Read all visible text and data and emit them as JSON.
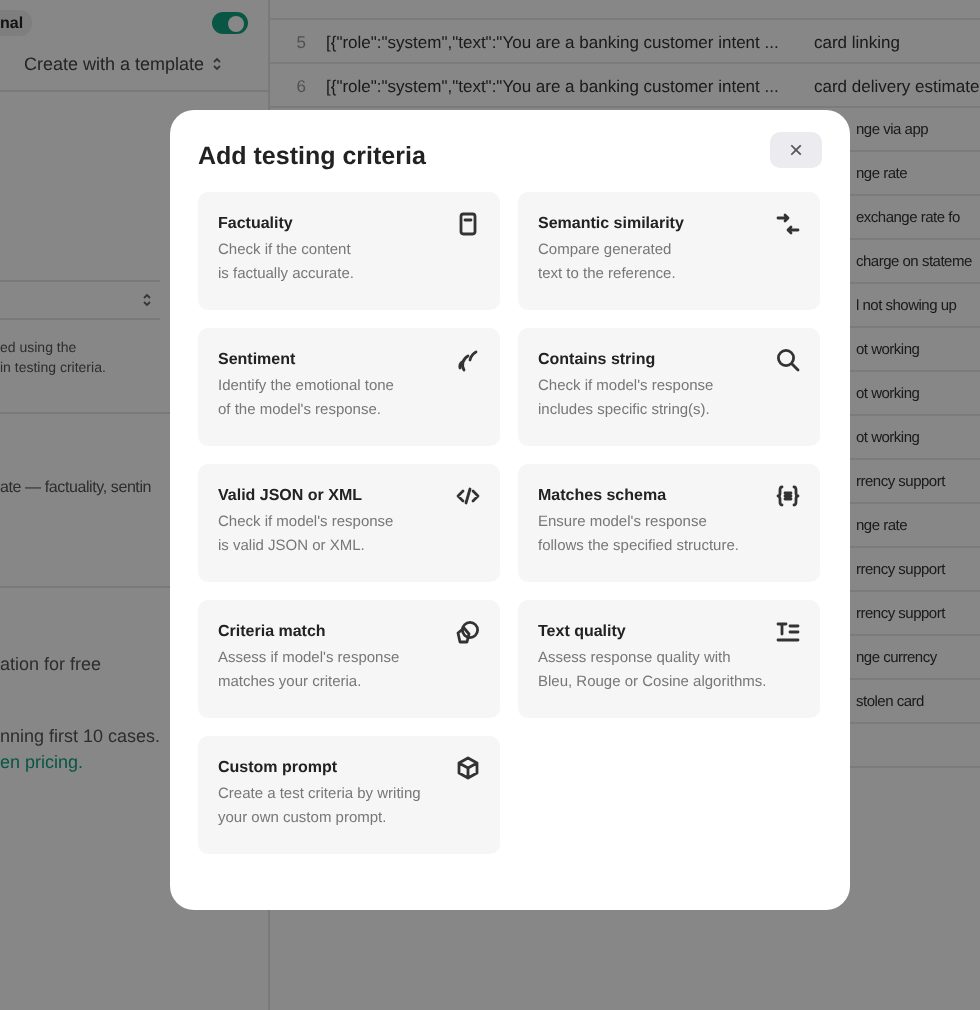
{
  "sidebar": {
    "badge": "nal",
    "toggle": {
      "on": true
    },
    "template_button": "Create with a template",
    "note": "ed using the\nin testing criteria.",
    "description": "ate — factuality, sentin",
    "free_text": "ation for free",
    "pricing_text": "nning first 10 cases.",
    "pricing_link": "en pricing."
  },
  "table": {
    "rows": [
      {
        "number": "",
        "prompt": "",
        "label": ""
      },
      {
        "number": "5",
        "prompt": "[{\"role\":\"system\",\"text\":\"You are a banking customer intent ...",
        "label": "card linking"
      },
      {
        "number": "6",
        "prompt": "[{\"role\":\"system\",\"text\":\"You are a banking customer intent ...",
        "label": "card delivery estimate"
      },
      {
        "number": "",
        "prompt": "",
        "label": "nge via app"
      },
      {
        "number": "",
        "prompt": "",
        "label": "nge rate"
      },
      {
        "number": "",
        "prompt": "",
        "label": "exchange rate fo"
      },
      {
        "number": "",
        "prompt": "",
        "label": "charge on stateme"
      },
      {
        "number": "",
        "prompt": "",
        "label": "l not showing up"
      },
      {
        "number": "",
        "prompt": "",
        "label": "ot working"
      },
      {
        "number": "",
        "prompt": "",
        "label": "ot working"
      },
      {
        "number": "",
        "prompt": "",
        "label": "ot working"
      },
      {
        "number": "",
        "prompt": "",
        "label": "rrency support"
      },
      {
        "number": "",
        "prompt": "",
        "label": "nge rate"
      },
      {
        "number": "",
        "prompt": "",
        "label": "rrency support"
      },
      {
        "number": "",
        "prompt": "",
        "label": "rrency support"
      },
      {
        "number": "",
        "prompt": "",
        "label": "nge currency"
      },
      {
        "number": "",
        "prompt": "",
        "label": "stolen card"
      },
      {
        "number": "",
        "prompt": "",
        "label": ""
      }
    ]
  },
  "dialog": {
    "title": "Add testing criteria",
    "close": "×",
    "criteria": [
      {
        "title": "Factuality",
        "description": "Check if the content\nis factually accurate."
      },
      {
        "title": "Semantic similarity",
        "description": "Compare generated\ntext to the reference."
      },
      {
        "title": "Sentiment",
        "description": "Identify the emotional tone\nof the model's response."
      },
      {
        "title": "Contains string",
        "description": "Check if model's response\nincludes specific string(s)."
      },
      {
        "title": "Valid JSON or XML",
        "description": "Check if model's response\nis valid JSON or XML."
      },
      {
        "title": "Matches schema",
        "description": "Ensure model's response\nfollows the specified structure."
      },
      {
        "title": "Criteria match",
        "description": "Assess if model's response\nmatches your criteria."
      },
      {
        "title": "Text quality",
        "description": "Assess response quality with\nBleu, Rouge or Cosine algorithms."
      },
      {
        "title": "Custom prompt",
        "description": "Create a test criteria by writing\nyour own custom prompt."
      }
    ]
  }
}
